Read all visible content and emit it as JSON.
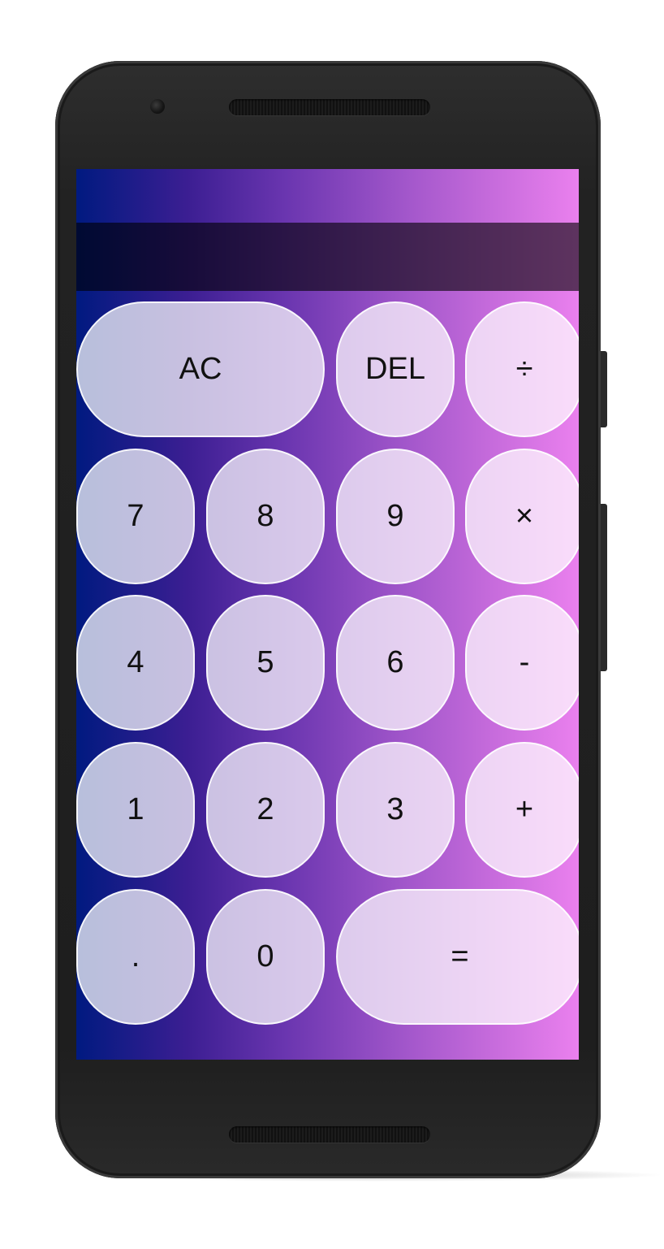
{
  "calculator": {
    "display": {
      "value": ""
    },
    "keys": {
      "ac": "AC",
      "del": "DEL",
      "divide": "÷",
      "seven": "7",
      "eight": "8",
      "nine": "9",
      "multiply": "×",
      "four": "4",
      "five": "5",
      "six": "6",
      "minus": "-",
      "one": "1",
      "two": "2",
      "three": "3",
      "plus": "+",
      "decimal": ".",
      "zero": "0",
      "equals": "="
    }
  },
  "colors": {
    "gradient_start": "#001a80",
    "gradient_end": "#ea80ee",
    "display_overlay": "#000000",
    "key_fill": "#ffffff",
    "key_text": "#111111",
    "phone_body": "#222222"
  }
}
